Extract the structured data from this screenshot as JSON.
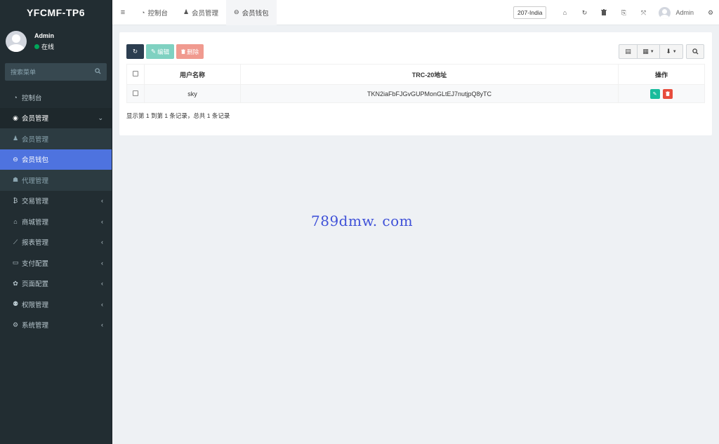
{
  "app": {
    "logo": "YFCMF-TP6"
  },
  "user": {
    "name": "Admin",
    "status": "在线"
  },
  "search": {
    "placeholder": "搜索菜单"
  },
  "sidebar": {
    "items": [
      {
        "label": "控制台",
        "icon": "dashboard-icon"
      },
      {
        "label": "会员管理",
        "icon": "user-circle-icon"
      },
      {
        "label": "会员管理",
        "icon": "user-icon"
      },
      {
        "label": "会员钱包",
        "icon": "wallet-icon"
      },
      {
        "label": "代理管理",
        "icon": "sitemap-icon"
      },
      {
        "label": "交易管理",
        "icon": "bitcoin-icon"
      },
      {
        "label": "商城管理",
        "icon": "home-icon"
      },
      {
        "label": "报表管理",
        "icon": "line-chart-icon"
      },
      {
        "label": "支付配置",
        "icon": "credit-card-icon"
      },
      {
        "label": "页面配置",
        "icon": "gear-icon"
      },
      {
        "label": "权限管理",
        "icon": "users-icon"
      },
      {
        "label": "系统管理",
        "icon": "cogs-icon"
      }
    ]
  },
  "topbar": {
    "tabs": [
      {
        "label": "控制台",
        "icon": "dashboard-icon"
      },
      {
        "label": "会员管理",
        "icon": "user-icon"
      },
      {
        "label": "会员钱包",
        "icon": "wallet-icon"
      }
    ],
    "region": "207-India",
    "admin_name": "Admin"
  },
  "toolbar": {
    "edit_label": "编辑",
    "delete_label": "删除"
  },
  "table": {
    "headers": [
      "用户名称",
      "TRC-20地址",
      "操作"
    ],
    "rows": [
      {
        "username": "sky",
        "address": "TKN2iaFbFJGvGUPMonGLtEJ7nutjpQ8yTC"
      }
    ]
  },
  "pager": {
    "info": "显示第 1 到第 1 条记录，总共 1 条记录"
  },
  "watermark": "789dmw. com",
  "colors": {
    "sidebar_bg": "#222d32",
    "active_menu": "#4e73df",
    "edit": "#18bc9c",
    "delete": "#e74c3c"
  }
}
